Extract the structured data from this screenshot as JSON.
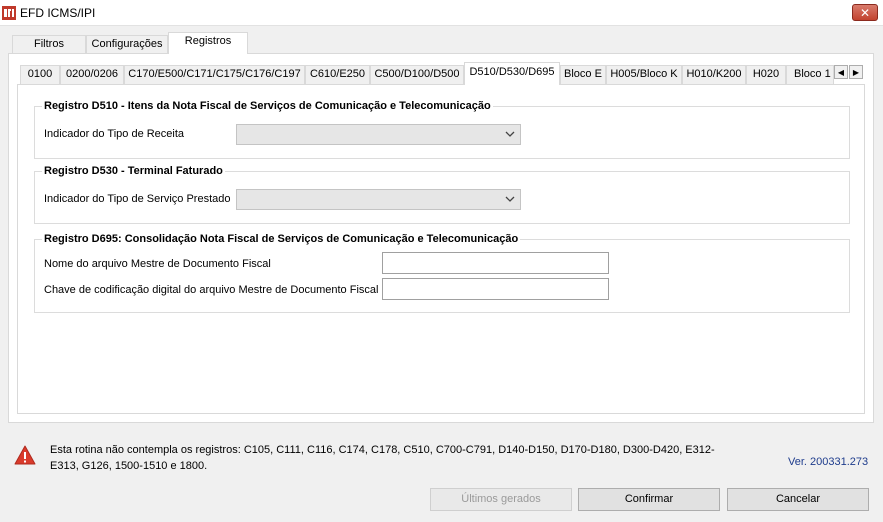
{
  "window": {
    "title": "EFD ICMS/IPI",
    "close": "✕"
  },
  "outer_tabs": [
    "Filtros",
    "Configurações",
    "Registros"
  ],
  "inner_tabs": [
    "0100",
    "0200/0206",
    "C170/E500/C171/C175/C176/C197",
    "C610/E250",
    "C500/D100/D500",
    "D510/D530/D695",
    "Bloco E",
    "H005/Bloco K",
    "H010/K200",
    "H020",
    "Bloco 1"
  ],
  "tab_scroll": {
    "left": "◀",
    "right": "▶"
  },
  "group_d510": {
    "title": "Registro D510 - Itens da Nota Fiscal de Serviços de Comunicação e Telecomunicação",
    "field_label": "Indicador do Tipo de Receita",
    "value": ""
  },
  "group_d530": {
    "title": "Registro D530 - Terminal Faturado",
    "field_label": "Indicador do Tipo de Serviço Prestado",
    "value": ""
  },
  "group_d695": {
    "title": "Registro D695: Consolidação Nota Fiscal de Serviços de Comunicação e Telecomunicação",
    "file_label": "Nome do arquivo Mestre de Documento Fiscal",
    "file_value": "",
    "key_label": "Chave de codificação digital do arquivo Mestre de Documento Fiscal",
    "key_value": ""
  },
  "notice": {
    "text": "Esta rotina não contempla os registros: C105, C111, C116, C174, C178, C510, C700-C791, D140-D150, D170-D180, D300-D420, E312-E313, G126, 1500-1510 e 1800.",
    "version": "Ver. 200331.273"
  },
  "buttons": {
    "last": "Últimos gerados",
    "confirm": "Confirmar",
    "cancel": "Cancelar"
  },
  "colors": {
    "close": "#c2422f",
    "warning": "#d93a2b",
    "version": "#1e3c8c"
  }
}
